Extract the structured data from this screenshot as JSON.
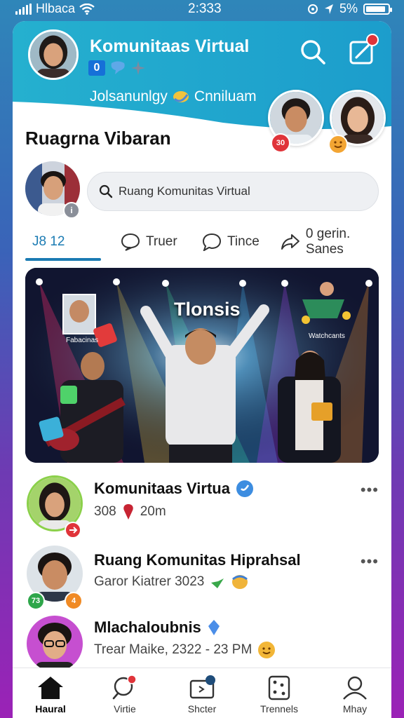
{
  "status_bar": {
    "carrier": "Hlbaca",
    "time": "2:333",
    "battery_text": "5%",
    "battery_level": 0.9
  },
  "header": {
    "title": "Komunitaas Virtual",
    "badge_number": "0",
    "subtitle": "Jolsanunlgy",
    "subtitle_2": "Cnniluam",
    "story_badge_1": "30"
  },
  "section": {
    "title": "Ruagrna Vibaran"
  },
  "search": {
    "placeholder": "Ruang Komunitas Virtual"
  },
  "tabs": [
    {
      "label": "J8 12"
    },
    {
      "label": "Truer"
    },
    {
      "label": "Tince"
    },
    {
      "label": "0  gerin. Sanes"
    }
  ],
  "hero": {
    "caption": "Tlonsis",
    "left_tag": "Fabacinas",
    "right_tag": "Watchcants"
  },
  "list": [
    {
      "title": "Komunitaas Virtua",
      "sub_left": "308",
      "sub_right": "20m"
    },
    {
      "title": "Ruang Komunitas Hiprahsal",
      "sub": "Garor Kiatrer  3023",
      "badge_left": "73",
      "badge_right": "4"
    },
    {
      "title": "Mlachaloubnis",
      "sub": "Trear Maike, 2322 - 23 PM"
    }
  ],
  "more_label": "•••",
  "bottom_nav": [
    {
      "label": "Haural",
      "icon": "home-icon"
    },
    {
      "label": "Virtie",
      "icon": "search-icon"
    },
    {
      "label": "Shcter",
      "icon": "tv-icon"
    },
    {
      "label": "Trennels",
      "icon": "dice-icon"
    },
    {
      "label": "Mhay",
      "icon": "profile-icon"
    }
  ],
  "colors": {
    "accent": "#1b7bb3",
    "header": "#29a9c9",
    "badge_red": "#e0343a"
  }
}
